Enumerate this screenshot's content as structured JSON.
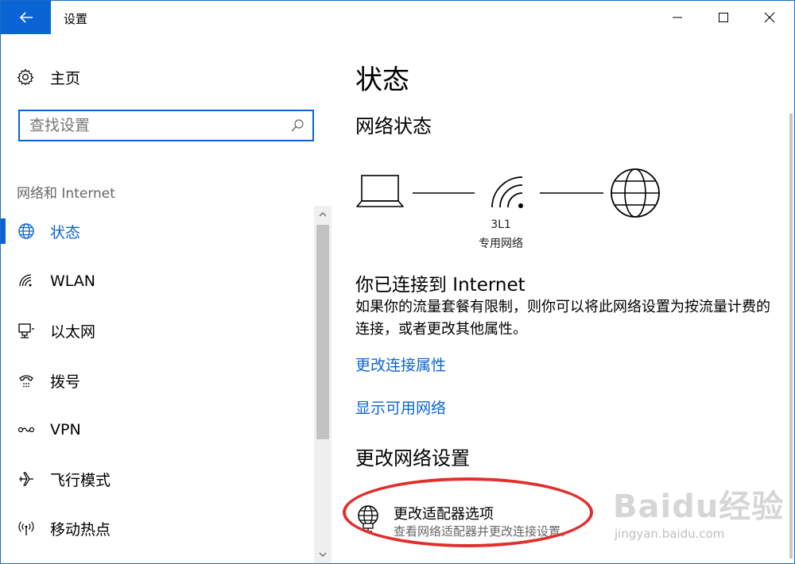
{
  "window": {
    "title": "设置",
    "accent": "#0a64d4"
  },
  "titlebar": {
    "back_icon": "arrow-left-icon",
    "minimize_icon": "minimize-icon",
    "maximize_icon": "maximize-icon",
    "close_icon": "close-icon"
  },
  "sidebar": {
    "home_label": "主页",
    "search_placeholder": "查找设置",
    "section_label": "网络和 Internet",
    "items": [
      {
        "label": "状态",
        "icon": "globe-icon",
        "active": true
      },
      {
        "label": "WLAN",
        "icon": "wifi-icon",
        "active": false
      },
      {
        "label": "以太网",
        "icon": "ethernet-icon",
        "active": false
      },
      {
        "label": "拨号",
        "icon": "dialup-icon",
        "active": false
      },
      {
        "label": "VPN",
        "icon": "vpn-icon",
        "active": false
      },
      {
        "label": "飞行模式",
        "icon": "airplane-icon",
        "active": false
      },
      {
        "label": "移动热点",
        "icon": "hotspot-icon",
        "active": false
      }
    ]
  },
  "main": {
    "page_title": "状态",
    "network_status_title": "网络状态",
    "network_name": "3L1",
    "network_type": "专用网络",
    "connected_title": "你已连接到 Internet",
    "connected_desc": "如果你的流量套餐有限制，则你可以将此网络设置为按流量计费的连接，或者更改其他属性。",
    "link_change_properties": "更改连接属性",
    "link_show_networks": "显示可用网络",
    "change_settings_title": "更改网络设置",
    "adapter_title": "更改适配器选项",
    "adapter_desc": "查看网络适配器并更改连接设置。"
  },
  "overlay": {
    "highlight_color": "#e0302d",
    "watermark_main": "Baidu经验",
    "watermark_url": "jingyan.baidu.com"
  }
}
